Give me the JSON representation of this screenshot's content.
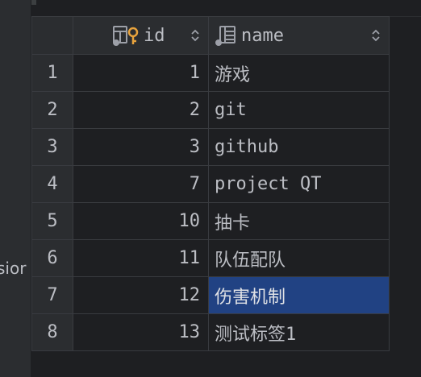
{
  "left_panel": {
    "clipped_text": "sior"
  },
  "table": {
    "columns": [
      {
        "label": "id",
        "icon": "primary-key-column-icon",
        "sort_icon": "sort-arrows-icon"
      },
      {
        "label": "name",
        "icon": "table-column-icon",
        "sort_icon": "sort-arrows-icon"
      }
    ],
    "rows": [
      {
        "num": "1",
        "id": "1",
        "name": "游戏"
      },
      {
        "num": "2",
        "id": "2",
        "name": "git"
      },
      {
        "num": "3",
        "id": "3",
        "name": "github"
      },
      {
        "num": "4",
        "id": "7",
        "name": "project QT"
      },
      {
        "num": "5",
        "id": "10",
        "name": "抽卡"
      },
      {
        "num": "6",
        "id": "11",
        "name": "队伍配队"
      },
      {
        "num": "7",
        "id": "12",
        "name": "伤害机制"
      },
      {
        "num": "8",
        "id": "13",
        "name": "测试标签1"
      }
    ],
    "selected_row_index": 6
  },
  "colors": {
    "background": "#1e1f22",
    "header": "#2b2d30",
    "selection": "#214283",
    "key_icon": "#e8a33d"
  }
}
